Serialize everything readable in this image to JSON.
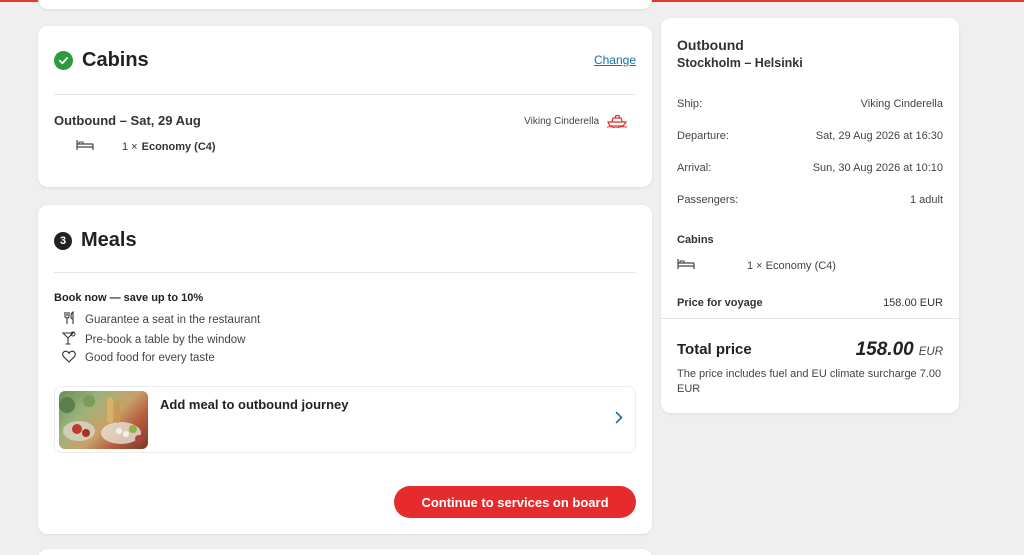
{
  "cabins": {
    "title": "Cabins",
    "change_label": "Change",
    "outbound_title": "Outbound – Sat, 29 Aug",
    "ship": "Viking Cinderella",
    "cabin_qty": "1 ×",
    "cabin_type": "Economy (C4)"
  },
  "meals": {
    "step": "3",
    "title": "Meals",
    "promo": "Book now — save up to 10%",
    "benefits": [
      "Guarantee a seat in the restaurant",
      "Pre-book a table by the window",
      "Good food for every taste"
    ],
    "tile_title": "Add meal to outbound journey",
    "cta_label": "Continue to services on board"
  },
  "summary": {
    "direction": "Outbound",
    "route": "Stockholm – Helsinki",
    "rows": [
      {
        "label": "Ship:",
        "value": "Viking Cinderella"
      },
      {
        "label": "Departure:",
        "value": "Sat, 29 Aug 2026 at 16:30"
      },
      {
        "label": "Arrival:",
        "value": "Sun, 30 Aug 2026 at 10:10"
      },
      {
        "label": "Passengers:",
        "value": "1 adult"
      }
    ],
    "cabins_title": "Cabins",
    "cabin_line": "1 × Economy (C4)",
    "voyage_label": "Price for voyage",
    "voyage_value": "158.00 EUR",
    "total_label": "Total price",
    "total_value": "158.00",
    "total_currency": "EUR",
    "total_note": "The price includes fuel and EU climate surcharge 7.00 EUR"
  },
  "colors": {
    "accent": "#e52b2b",
    "success": "#2e9b3e",
    "link": "#1b6fa8"
  }
}
